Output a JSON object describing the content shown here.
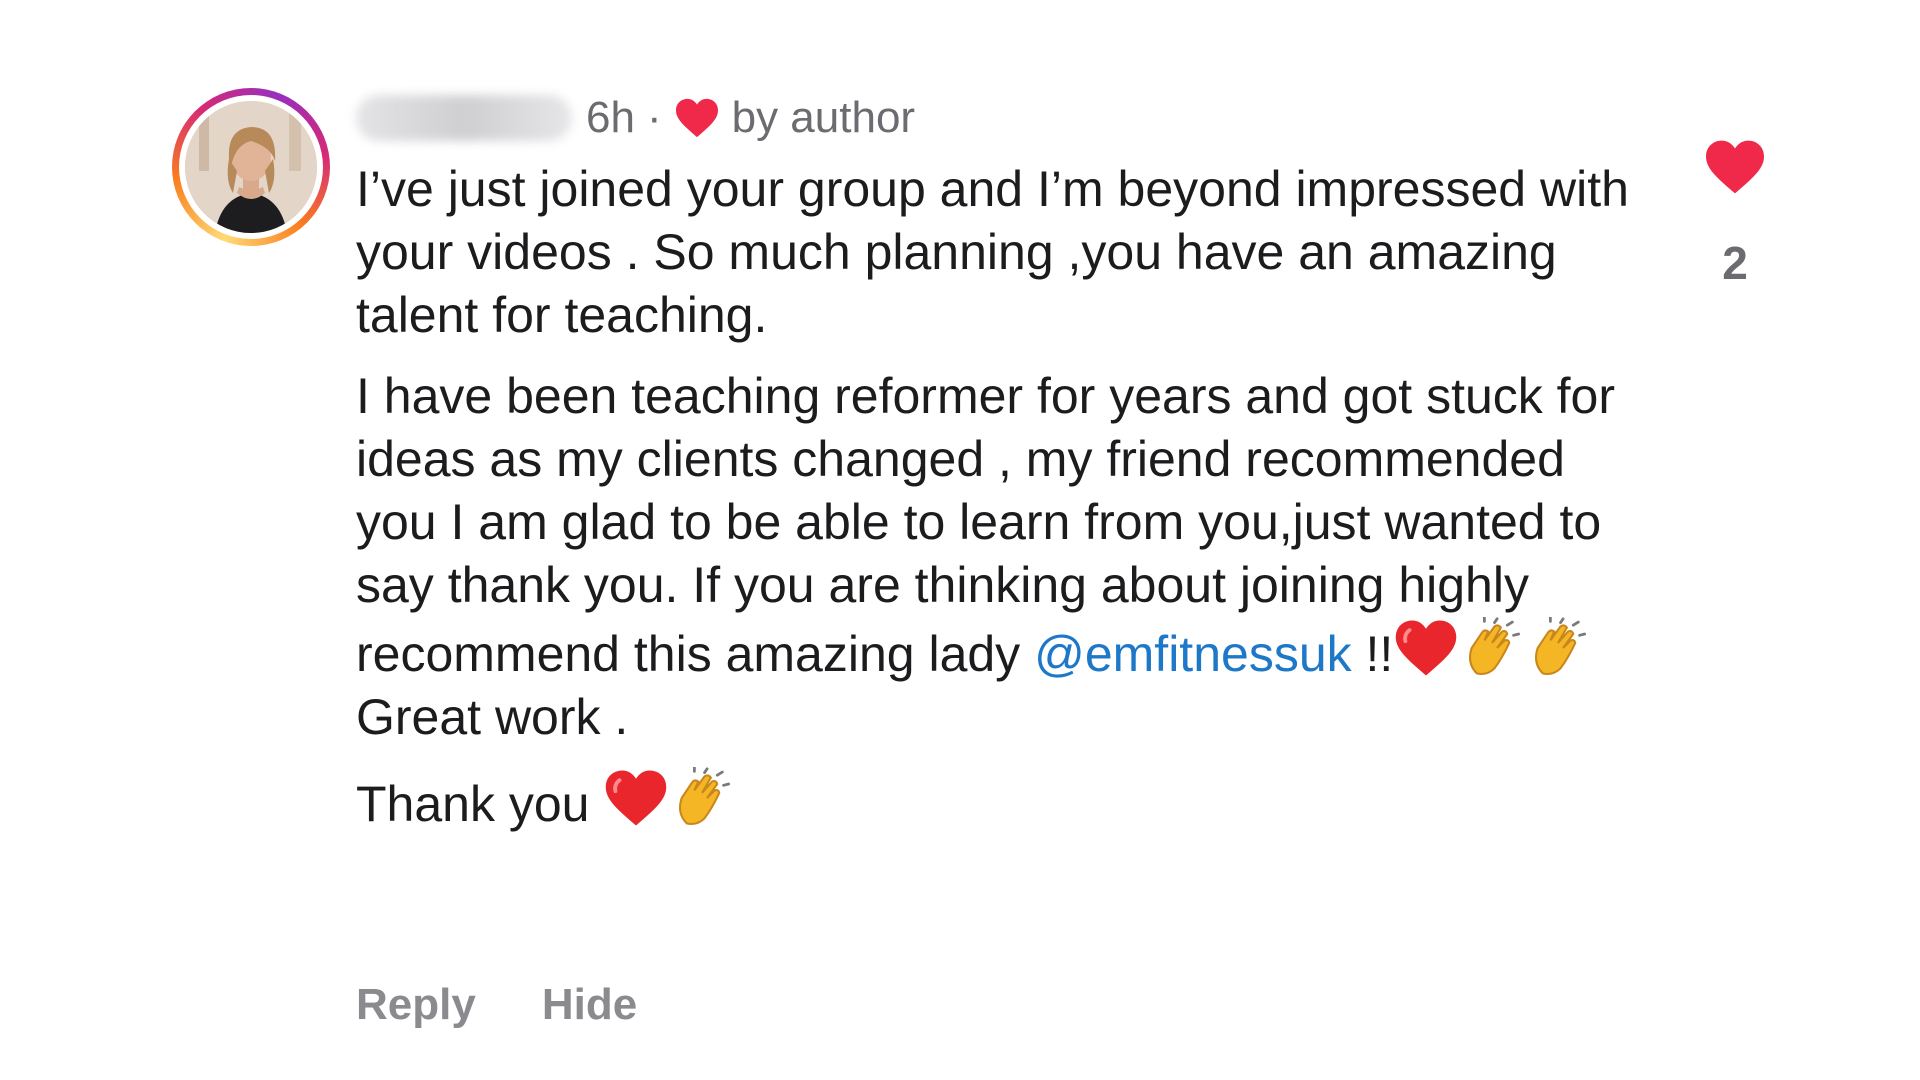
{
  "comment": {
    "time": "6h",
    "separator": "·",
    "liked_by": "by author",
    "paragraphs": [
      "I’ve just joined your group and I’m beyond impressed with your videos . So much planning ,you have an amazing talent for teaching.",
      "I have been teaching reformer for years and got stuck for ideas as my clients changed , my friend recommended you I am glad to be able to learn from you,just wanted to say thank you. If you are thinking about joining highly recommend this amazing lady"
    ],
    "mention": "@emfitnessuk",
    "after_mention": " !!",
    "great_text": "Great work .",
    "thanks_text": "Thank you",
    "like_count": "2"
  },
  "actions": {
    "reply_label": "Reply",
    "hide_label": "Hide"
  },
  "icons": {
    "author_heart": "heart-icon",
    "emoji_heart": "red-heart-emoji",
    "emoji_clap": "clapping-hands-emoji",
    "like": "heart-icon"
  },
  "colors": {
    "heart_red": "#f02849",
    "mention_blue": "#1e78c8",
    "muted_text": "#6b6b70"
  }
}
